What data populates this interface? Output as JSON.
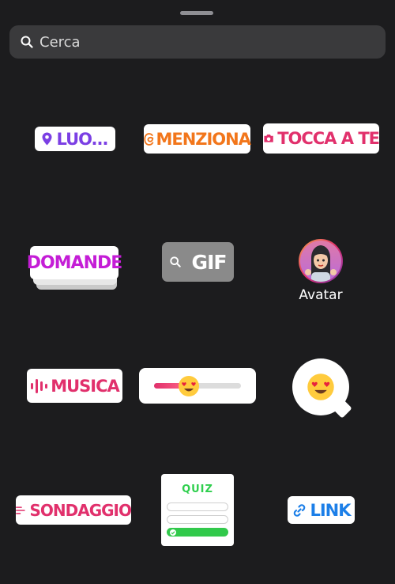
{
  "search": {
    "placeholder": "Cerca",
    "value": ""
  },
  "stickers": {
    "location": {
      "label": "LUO...",
      "color": "#7b3fe4"
    },
    "mention": {
      "label": "MENZIONA",
      "color": "#f2761b"
    },
    "add_yours": {
      "label": "TOCCA A TE",
      "color": "#e1306c"
    },
    "questions": {
      "label": "DOMANDE",
      "color": "#c41dd6"
    },
    "gif": {
      "label": "GIF"
    },
    "avatar": {
      "label": "Avatar"
    },
    "music": {
      "label": "MUSICA",
      "color": "#e1306c"
    },
    "emoji_slider": {
      "value": 0.4
    },
    "poll": {
      "label": "SONDAGGIO",
      "color": "#e1306c"
    },
    "quiz": {
      "label": "QUIZ",
      "color": "#2fcf4e"
    },
    "link": {
      "label": "LINK",
      "color": "#1c7fe8"
    }
  }
}
